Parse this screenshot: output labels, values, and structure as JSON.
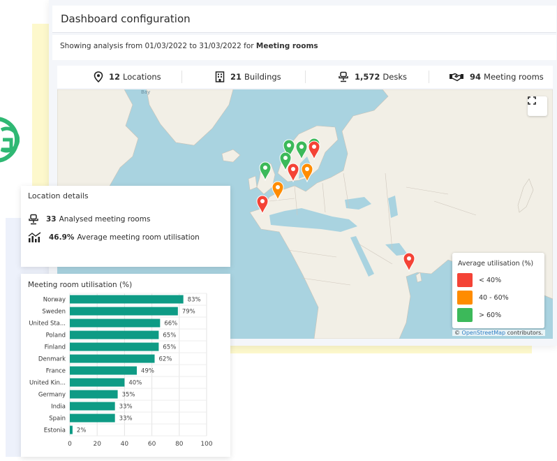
{
  "header": {
    "title": "Dashboard configuration",
    "subtitle_prefix": "Showing analysis from 01/03/2022 to 31/03/2022 for",
    "subtitle_bold": "Meeting rooms"
  },
  "stats": [
    {
      "icon": "location-pin-icon",
      "value": "12",
      "label": "Locations"
    },
    {
      "icon": "building-icon",
      "value": "21",
      "label": "Buildings"
    },
    {
      "icon": "desk-chair-icon",
      "value": "1,572",
      "label": "Desks"
    },
    {
      "icon": "handshake-icon",
      "value": "94",
      "label": "Meeting rooms"
    }
  ],
  "map": {
    "bay_label": "Bay",
    "fullscreen_icon": "fullscreen-icon",
    "attribution_prefix": "©",
    "attribution_link": "OpenStreetMap",
    "attribution_suffix": "contributors.",
    "markers": [
      {
        "status": "green"
      },
      {
        "status": "green"
      },
      {
        "status": "green"
      },
      {
        "status": "red"
      },
      {
        "status": "green"
      },
      {
        "status": "orange"
      },
      {
        "status": "red"
      },
      {
        "status": "green"
      },
      {
        "status": "orange"
      },
      {
        "status": "red"
      },
      {
        "status": "red"
      }
    ]
  },
  "legend": {
    "title": "Average utilisation (%)",
    "items": [
      {
        "label": "< 40%",
        "color": "#f44336"
      },
      {
        "label": "40 - 60%",
        "color": "#ff8c00"
      },
      {
        "label": "> 60%",
        "color": "#3cb95a"
      }
    ]
  },
  "colors": {
    "red": "#f44336",
    "orange": "#ff8c00",
    "green": "#3cb95a",
    "bar": "#0e9b85",
    "logo": "#2fb873"
  },
  "location_details": {
    "title": "Location details",
    "rows": [
      {
        "icon": "desk-chair-icon",
        "value": "33",
        "label": "Analysed meeting rooms"
      },
      {
        "icon": "chart-icon",
        "value": "46.9%",
        "label": "Average meeting room utilisation"
      }
    ]
  },
  "chart_data": {
    "type": "bar",
    "orientation": "horizontal",
    "title": "Meeting room utilisation (%)",
    "categories": [
      "Norway",
      "Sweden",
      "United Sta...",
      "Poland",
      "Finland",
      "Denmark",
      "France",
      "United Kin...",
      "Germany",
      "India",
      "Spain",
      "Estonia"
    ],
    "values": [
      83,
      79,
      66,
      65,
      65,
      62,
      49,
      40,
      35,
      33,
      33,
      2
    ],
    "data_labels": [
      "83%",
      "79%",
      "66%",
      "65%",
      "65%",
      "62%",
      "49%",
      "40%",
      "35%",
      "33%",
      "33%",
      "2%"
    ],
    "xlim": [
      0,
      100
    ],
    "xticks": [
      "0",
      "20",
      "40",
      "60",
      "80",
      "100"
    ],
    "grid": true,
    "xlabel": "",
    "ylabel": ""
  }
}
